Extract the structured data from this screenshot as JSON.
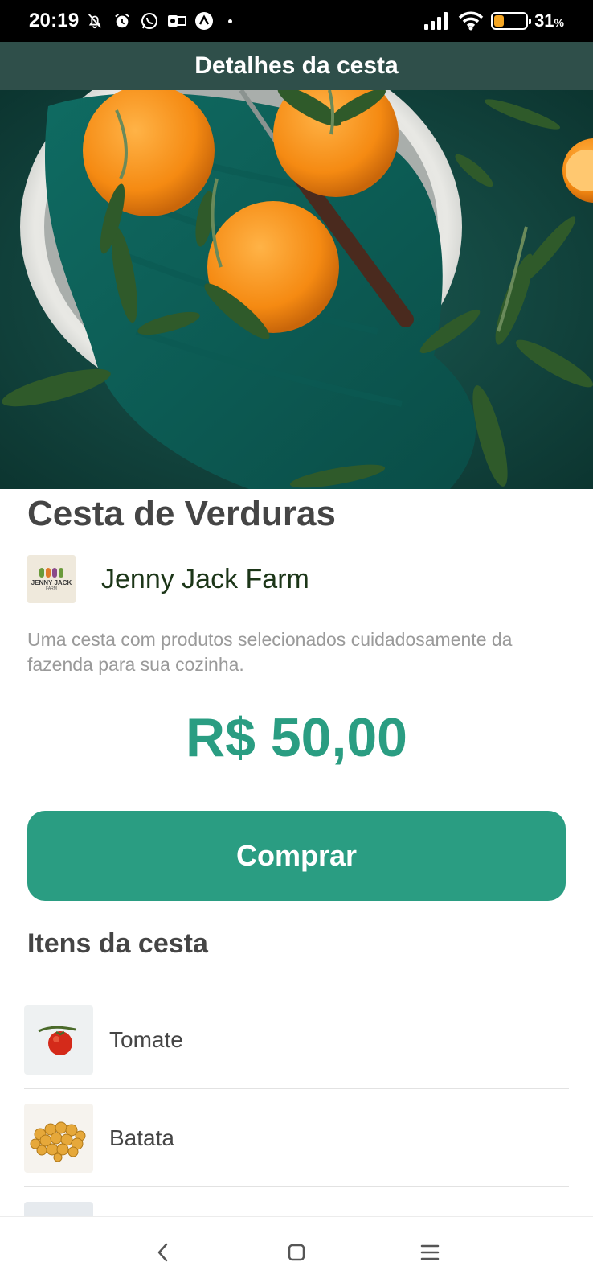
{
  "status_bar": {
    "time": "20:19",
    "battery_percent": "31",
    "battery_unit": "%",
    "battery_level": 0.31,
    "icons": [
      "bell-off-icon",
      "alarm-icon",
      "whatsapp-icon",
      "outlook-icon",
      "app-icon",
      "dot",
      "signal-icon",
      "wifi-icon",
      "battery-icon"
    ]
  },
  "header": {
    "title": "Detalhes da cesta"
  },
  "product": {
    "title": "Cesta de Verduras",
    "farm_name": "Jenny Jack Farm",
    "farm_logo_text": "JENNY JACK",
    "farm_logo_sub": "FARM",
    "description": "Uma cesta com produtos selecionados cuidadosamente da fazenda para sua cozinha.",
    "price": "R$ 50,00",
    "buy_label": "Comprar"
  },
  "items_section": {
    "title": "Itens da cesta",
    "items": [
      {
        "name": "Tomate",
        "icon": "tomato-image"
      },
      {
        "name": "Batata",
        "icon": "potato-image"
      },
      {
        "name": "",
        "icon": "vegetable-image"
      }
    ]
  },
  "colors": {
    "header_bg": "#2f4f4a",
    "accent": "#2a9d82",
    "farm_text": "#1c3618"
  },
  "nav": {
    "buttons": [
      "back",
      "home",
      "menu"
    ]
  }
}
